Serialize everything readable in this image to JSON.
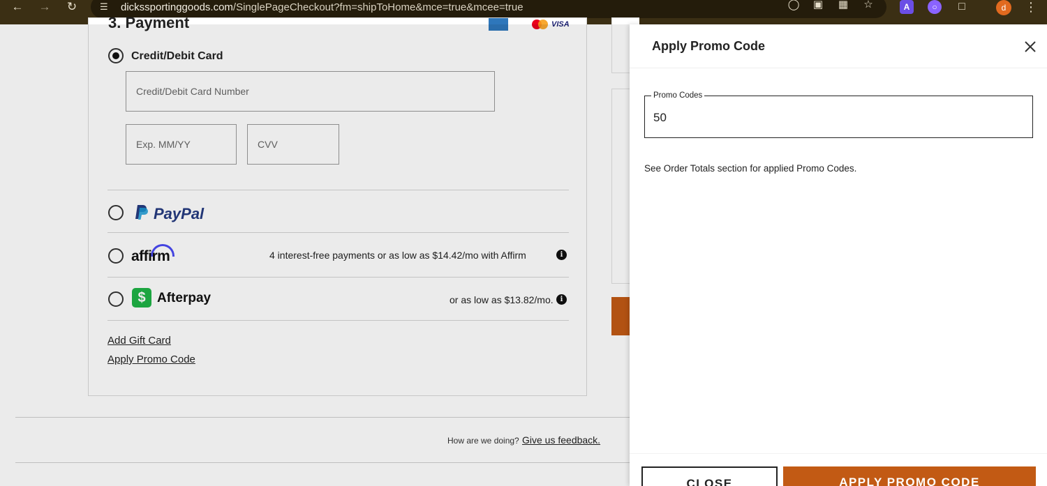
{
  "browser": {
    "url_host": "dickssportinggoods.com",
    "url_path": "/SinglePageCheckout?fm=shipToHome&mce=true&mcee=true",
    "profile_initial": "d",
    "icons": [
      "back-icon",
      "forward-icon",
      "reload-icon",
      "site-info-icon",
      "eye-off-icon",
      "install-app-icon",
      "translate-icon",
      "bookmark-star-icon",
      "extension-a-icon",
      "extension-circle-icon",
      "extensions-puzzle-icon",
      "menu-dots-icon"
    ]
  },
  "payment": {
    "heading": "3. Payment",
    "card_option_label": "Credit/Debit Card",
    "card_number_placeholder": "Credit/Debit Card Number",
    "exp_placeholder": "Exp. MM/YY",
    "cvv_placeholder": "CVV",
    "paypal_label": "PayPal",
    "affirm_label": "affirm",
    "affirm_promo": "4 interest-free payments or as low as $14.42/mo with Affirm",
    "afterpay_label": "Afterpay",
    "afterpay_promo": "or as low as $13.82/mo.",
    "add_gift_card": "Add Gift Card",
    "apply_promo_code": "Apply Promo Code"
  },
  "footer": {
    "feedback_question": "How are we doing?",
    "feedback_link": "Give us feedback."
  },
  "drawer": {
    "title": "Apply Promo Code",
    "field_label": "Promo Codes",
    "field_value": "50",
    "note": "See Order Totals section for applied Promo Codes.",
    "close_button": "CLOSE",
    "apply_button": "APPLY PROMO CODE"
  },
  "colors": {
    "brand_orange": "#c25a14",
    "browser_bar": "#3b2f14",
    "afterpay_green": "#1fb446",
    "paypal_blue": "#253b80",
    "affirm_arc": "#4a4af4"
  }
}
